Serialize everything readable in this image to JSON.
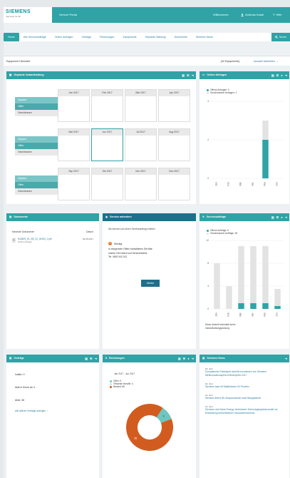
{
  "header": {
    "brand": "SIEMENS",
    "tagline": "Ingenuity for life",
    "portal_title": "Service Portal",
    "welcome": "Willkommen",
    "user": "Andreas Kalari",
    "help": "Hilfe"
  },
  "nav": {
    "tabs": [
      "Home",
      "Alle Serviceaufträge",
      "Online Anfragen",
      "Verträge",
      "Rechnungen",
      "Equipments",
      "Geplante Wartung",
      "Dokumente",
      "Siemens News"
    ],
    "search": "Suche"
  },
  "page": {
    "title": "Equipment Übersicht",
    "count": "[42 Equipments]",
    "selection": "Auswahl bearbeiten"
  },
  "maintenance": {
    "title": "Geplante Instandhaltung",
    "row_labels": [
      "Geplant",
      "Offen",
      "Geschlossen"
    ],
    "months": [
      [
        "Jan 2017",
        "Feb 2017",
        "Mär 2017",
        "Apr 2017"
      ],
      [
        "Mai 2017",
        "Jun 2017",
        "Jul 2017",
        "Aug 2017"
      ],
      [
        "Sep 2017",
        "Okt 2017",
        "Nov 2017",
        "Dez 2017"
      ]
    ]
  },
  "online_requests": {
    "title": "Online Anfragen",
    "legend": [
      "Offene Anfragen: 0",
      "Geschlossene Anfragen: 1"
    ],
    "y_ticks": [
      "4",
      "2",
      "0"
    ],
    "x_ticks": [
      "Jan",
      "Feb",
      "Mär",
      "Apr",
      "Mai",
      "Jun"
    ]
  },
  "documents": {
    "title": "Dokumente",
    "col_new": "Neueste Dokumente",
    "col_date": "Datum",
    "file": "H44809_S1_BE_02_00493_1.pdf",
    "file_date": "02.05.2017",
    "file_sub": "Online Anfrage"
  },
  "service_request": {
    "title": "Service anfordern",
    "intro": "Sie können uns einen Serviceauftrag erteilen",
    "warn_title": "Wichtig:",
    "warn_lines": [
      "In dringenden Fällen kontaktieren Sie bitte",
      "unsere 24h Notruf und Servicehotline",
      "Tel. 0842 942 012"
    ],
    "button": "Weiter"
  },
  "service_orders": {
    "title": "Serviceaufträge",
    "legend": [
      "Offene Aufträge: 5",
      "Geschlossene Aufträge: 45"
    ],
    "y_ticks": [
      "12",
      "8",
      "4",
      "0"
    ],
    "x_ticks": [
      "Jan",
      "Feb",
      "Mär",
      "Apr",
      "Mai",
      "Jun"
    ],
    "note": "Diese Ansicht beinhaltet keine Instandhaltungsplanung"
  },
  "contracts": {
    "title": "Verträge",
    "lines": [
      "Inaktiv: 0",
      "läuft in Kürze ab: 0",
      "Aktiv: 38"
    ],
    "link": "Alle aktiven Verträge anzeigen"
  },
  "invoices": {
    "title": "Rechnungen",
    "period": "Jan 2017 - Jun 2017",
    "legend": [
      "Offen: 9",
      "Teilweise bezahlt: 0",
      "Bezahlt: 85"
    ],
    "slice_labels": [
      "9",
      "85"
    ]
  },
  "news": {
    "title": "Siemens News",
    "items": [
      {
        "date": "19. Juni",
        "text": "Europäisches Patentamt verleiht Innovatoren von Siemens Weltinnovationspreis Erfinderpreis 2017"
      },
      {
        "date": "19. Juni",
        "text": "Siemens baut elf Stadtbahnen für Phoenix"
      },
      {
        "date": "14. Juni",
        "text": "Siemens liefert 48 Umspannwerke nach Bangladesch"
      },
      {
        "date": "13. Juni",
        "text": "Siemens und Dubai Energy vereinbaren Technologiepartnerschaft zur Entwicklung fortschrittlicher Gasturbinentechnik"
      }
    ]
  },
  "colors": {
    "teal": "#2fa3a6",
    "darkteal": "#1f6f8b",
    "orange": "#d25c1f",
    "lightgray": "#e3e3e3"
  },
  "chart_data": [
    {
      "type": "bar",
      "title": "Online Anfragen",
      "categories": [
        "Jan",
        "Feb",
        "Mär",
        "Apr",
        "Mai",
        "Jun"
      ],
      "series": [
        {
          "name": "Offene Anfragen",
          "values": [
            0,
            0,
            0,
            0,
            2,
            0
          ]
        },
        {
          "name": "Geschlossene Anfragen",
          "values": [
            0,
            0,
            0,
            0,
            1,
            0
          ]
        }
      ],
      "ylim": [
        0,
        4
      ]
    },
    {
      "type": "bar",
      "title": "Serviceaufträge",
      "categories": [
        "Jan",
        "Feb",
        "Mär",
        "Apr",
        "Mai",
        "Jun"
      ],
      "series": [
        {
          "name": "Offene Aufträge",
          "values": [
            0,
            0,
            1,
            1,
            1,
            0.5
          ]
        },
        {
          "name": "Geschlossene Aufträge",
          "values": [
            8,
            4,
            10,
            10,
            10,
            3
          ]
        }
      ],
      "ylim": [
        0,
        12
      ]
    },
    {
      "type": "pie",
      "title": "Rechnungen",
      "categories": [
        "Offen",
        "Teilweise bezahlt",
        "Bezahlt"
      ],
      "values": [
        9,
        0,
        85
      ]
    }
  ]
}
